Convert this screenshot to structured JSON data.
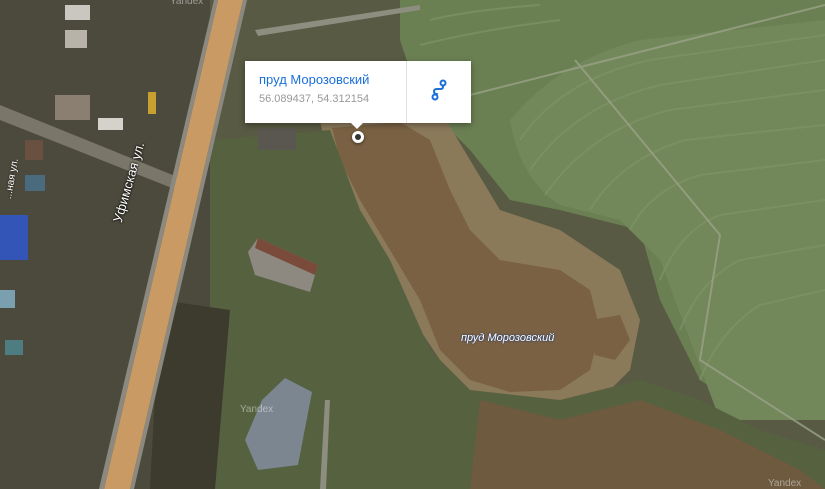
{
  "map": {
    "street_label": "Уфимская ул.",
    "street_label_small": "...ная ул.",
    "pond_label": "пруд Морозовский",
    "watermark_text": "Yandex",
    "colors": {
      "road": "#c99a63",
      "pond": "#7a6143",
      "field": "#6c8353",
      "grass": "#5f6b43"
    }
  },
  "popup": {
    "title": "пруд Морозовский",
    "coordinates": "56.089437, 54.312154",
    "route_icon": "route-icon",
    "accent": "#1a6fd8"
  }
}
